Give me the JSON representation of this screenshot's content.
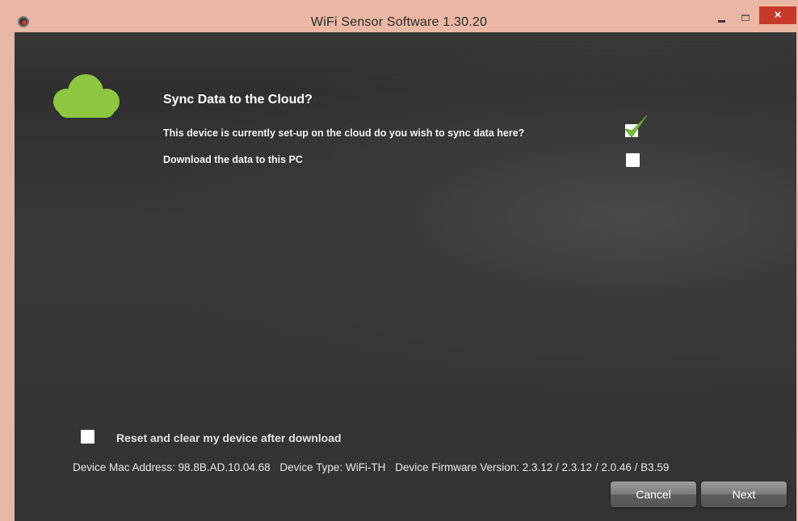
{
  "window": {
    "title": "WiFi Sensor Software 1.30.20",
    "close_label": "×"
  },
  "sync": {
    "heading": "Sync Data to the Cloud?",
    "option_cloud": "This device is currently set-up on the cloud do you wish to sync data here?",
    "option_cloud_checked": true,
    "option_download": "Download the data to this PC",
    "option_download_checked": false
  },
  "reset": {
    "label": "Reset and clear my device after download",
    "checked": false
  },
  "device_info": {
    "mac": "Device Mac Address: 98.8B.AD.10.04.68",
    "type": "Device Type: WiFi-TH",
    "firmware": "Device Firmware Version: 2.3.12 / 2.3.12 / 2.0.46 / B3.59"
  },
  "buttons": {
    "cancel": "Cancel",
    "next": "Next"
  },
  "colors": {
    "cloud": "#8dc63f",
    "check": "#7cc043",
    "close_button": "#c7392b"
  },
  "icons": {
    "app": "app-icon",
    "cloud": "cloud-icon",
    "check": "checkmark-icon",
    "minimize": "minimize-icon",
    "maximize": "maximize-icon",
    "close": "close-icon"
  }
}
